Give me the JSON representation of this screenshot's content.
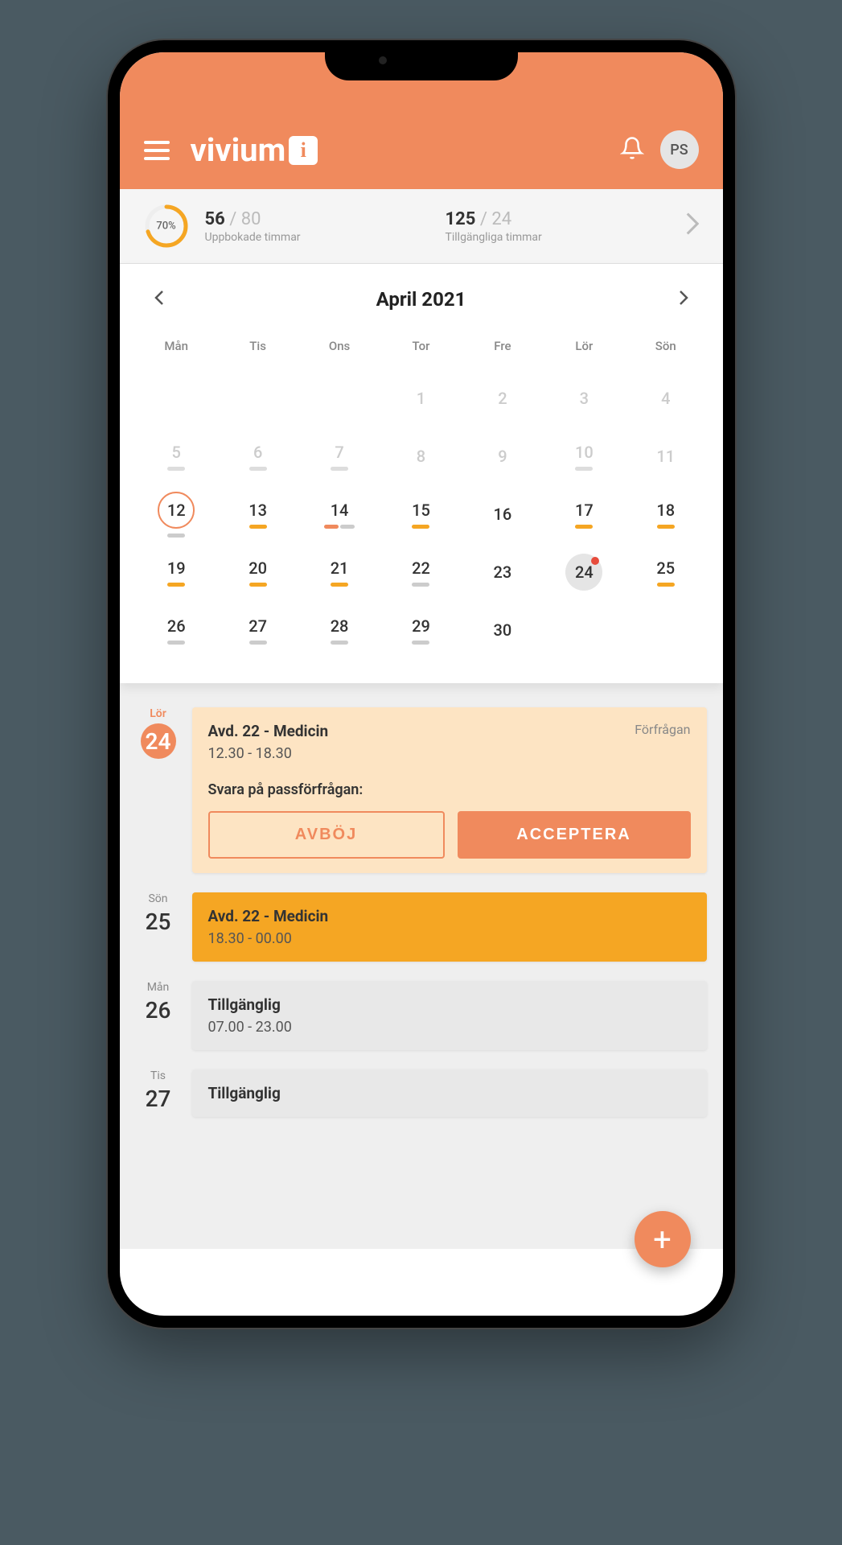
{
  "header": {
    "logo_text": "vivium",
    "logo_badge": "i",
    "avatar_initials": "PS"
  },
  "stats": {
    "progress_pct": "70%",
    "booked_current": "56",
    "booked_total": "80",
    "booked_label": "Uppbokade timmar",
    "avail_current": "125",
    "avail_total": "24",
    "avail_label": "Tillgängliga timmar"
  },
  "calendar": {
    "title": "April 2021",
    "dow": [
      "Mån",
      "Tis",
      "Ons",
      "Tor",
      "Fre",
      "Lör",
      "Sön"
    ],
    "cells": [
      {
        "n": "",
        "cls": "empty"
      },
      {
        "n": "",
        "cls": "empty"
      },
      {
        "n": "",
        "cls": "empty"
      },
      {
        "n": "1",
        "cls": "muted"
      },
      {
        "n": "2",
        "cls": "muted"
      },
      {
        "n": "3",
        "cls": "muted"
      },
      {
        "n": "4",
        "cls": "muted"
      },
      {
        "n": "5",
        "cls": "muted",
        "ul": "grey"
      },
      {
        "n": "6",
        "cls": "muted",
        "ul": "grey"
      },
      {
        "n": "7",
        "cls": "muted",
        "ul": "grey"
      },
      {
        "n": "8",
        "cls": "muted"
      },
      {
        "n": "9",
        "cls": "muted"
      },
      {
        "n": "10",
        "cls": "muted",
        "ul": "grey"
      },
      {
        "n": "11",
        "cls": "muted"
      },
      {
        "n": "12",
        "cls": "today",
        "ul": "grey"
      },
      {
        "n": "13",
        "ul": "orange"
      },
      {
        "n": "14",
        "multi": [
          "pink",
          "grey"
        ]
      },
      {
        "n": "15",
        "ul": "orange"
      },
      {
        "n": "16"
      },
      {
        "n": "17",
        "ul": "orange"
      },
      {
        "n": "18",
        "ul": "orange"
      },
      {
        "n": "19",
        "ul": "orange"
      },
      {
        "n": "20",
        "ul": "orange"
      },
      {
        "n": "21",
        "ul": "orange"
      },
      {
        "n": "22",
        "ul": "grey"
      },
      {
        "n": "23"
      },
      {
        "n": "24",
        "cls": "selected",
        "dot": true
      },
      {
        "n": "25",
        "ul": "orange"
      },
      {
        "n": "26",
        "ul": "grey"
      },
      {
        "n": "27",
        "ul": "grey"
      },
      {
        "n": "28",
        "ul": "grey"
      },
      {
        "n": "29",
        "ul": "grey"
      },
      {
        "n": "30"
      }
    ]
  },
  "events": [
    {
      "dow": "Lör",
      "day": "24",
      "accent": true,
      "badge": true,
      "type": "request",
      "title": "Avd. 22 - Medicin",
      "tag": "Förfrågan",
      "time": "12.30 - 18.30",
      "prompt": "Svara på passförfrågan:",
      "decline": "AVBÖJ",
      "accept": "ACCEPTERA"
    },
    {
      "dow": "Sön",
      "day": "25",
      "type": "shift",
      "title": "Avd. 22 - Medicin",
      "time": "18.30 - 00.00"
    },
    {
      "dow": "Mån",
      "day": "26",
      "type": "avail",
      "title": "Tillgänglig",
      "time": "07.00 - 23.00"
    },
    {
      "dow": "Tis",
      "day": "27",
      "type": "avail",
      "title": "Tillgänglig",
      "time": ""
    }
  ],
  "fab": "+"
}
